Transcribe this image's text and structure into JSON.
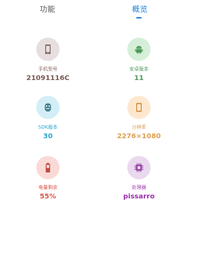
{
  "tabs": {
    "functions": "功能",
    "overview": "概览"
  },
  "cards": {
    "model": {
      "label": "手机型号",
      "value": "21091116C",
      "icon": "phone-icon",
      "bg": "#e7dede",
      "label_color": "#8a6a66",
      "value_color": "#7a5a54"
    },
    "android": {
      "label": "安卓版本",
      "value": "11",
      "icon": "android-icon",
      "bg": "#d6efd9",
      "label_color": "#4e9a58",
      "value_color": "#4e9a58"
    },
    "sdk": {
      "label": "SDK版本",
      "value": "30",
      "icon": "sdk-icon",
      "bg": "#d3eef6",
      "label_color": "#2ba7cc",
      "value_color": "#2ba7cc"
    },
    "resolution": {
      "label": "分辨率",
      "value": "2276×1080",
      "icon": "screen-icon",
      "bg": "#fde8cf",
      "label_color": "#e0a050",
      "value_color": "#e0a050"
    },
    "battery": {
      "label": "电量剩余",
      "value": "55%",
      "icon": "battery-icon",
      "bg": "#f9dad6",
      "label_color": "#d9584a",
      "value_color": "#d9584a"
    },
    "cpu": {
      "label": "处理器",
      "value": "pissarro",
      "icon": "cpu-icon",
      "bg": "#ead8ef",
      "label_color": "#a040b0",
      "value_color": "#9a30aa"
    }
  }
}
